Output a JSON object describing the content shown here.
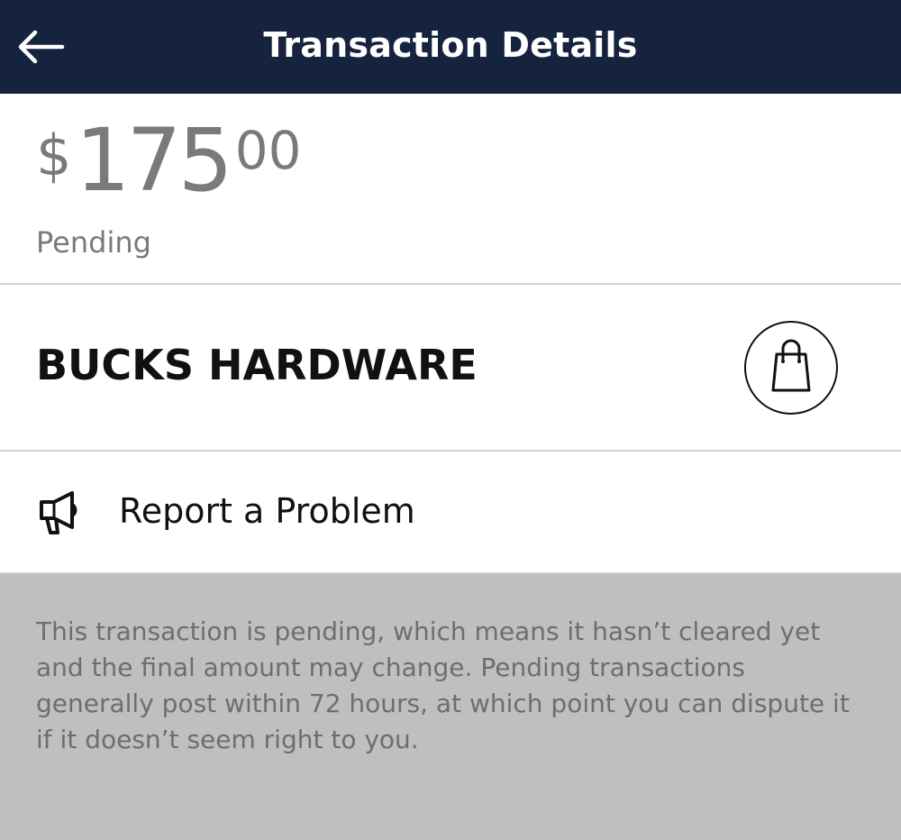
{
  "header": {
    "title": "Transaction Details",
    "back_icon": "arrow-left-icon",
    "background_color": "#15233f"
  },
  "transaction": {
    "currency_symbol": "$",
    "amount_whole": "175",
    "amount_cents": "00",
    "status": "Pending"
  },
  "merchant": {
    "name": "BUCKS HARDWARE",
    "category_icon": "shopping-bag-icon"
  },
  "report": {
    "label": "Report a Problem",
    "icon": "megaphone-icon"
  },
  "info": {
    "text": "This transaction is pending, which means it hasn’t cleared yet and the final amount may change. Pending transactions generally post within 72 hours, at which point you can dispute it if it doesn’t seem right to you."
  }
}
